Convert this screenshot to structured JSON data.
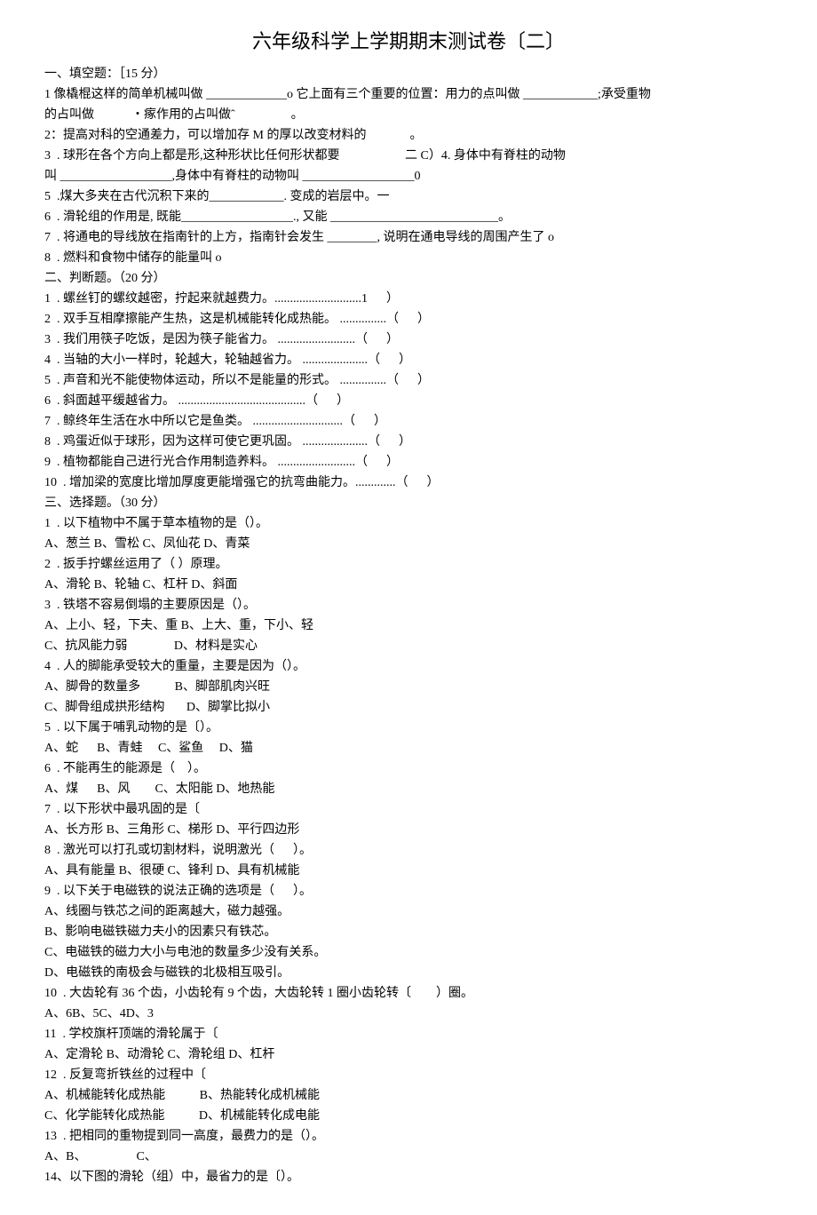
{
  "title": "六年级科学上学期期末测试卷〔二〕",
  "sections": {
    "fill": {
      "header": "一、填空题：［15 分）",
      "q1a": "1 像橇棍这样的简单机械叫做 _____________o 它上面有三个重要的位置：用力的点叫做 ____________;承受重物",
      "q1b": "的占叫做            ・瘃作用的占叫做ˆ                  。",
      "q2": "2：提高对科的空通差力，可以增加存 M 的厚以改变材料的              。",
      "q3": "3  . 球形在各个方向上都是形,这种形状比任何形状都要                     二 C）4. 身体中有脊柱的动物",
      "q3b": "叫 __________________,身体中有脊柱的动物叫 __________________0",
      "q5": "5  .煤大多夹在古代沉积下来的____________. 变成的岩层中。一",
      "q6": "6  . 滑轮组的作用是, 既能__________________., 又能 ___________________________。",
      "q7": "7  . 将通电的导线放在指南针的上方，指南针会发生 ________, 说明在通电导线的周围产生了 o",
      "q8": "8  . 燃料和食物中储存的能量叫 o"
    },
    "judge": {
      "header": "二、判断题。（20 分）",
      "items": [
        "1  . 螺丝钉的螺纹越密，拧起来就越费力。............................1      ）",
        "2  . 双手互相摩擦能产生热，这是机械能转化成热能。 ...............（      ）",
        "3  . 我们用筷子吃饭，是因为筷子能省力。 .........................（      ）",
        "4  . 当轴的大小一样时，轮越大，轮轴越省力。 .....................（      ）",
        "5  . 声音和光不能使物体运动，所以不是能量的形式。 ...............（      ）",
        "6  . 斜面越平缓越省力。 .........................................（      ）",
        "7  . 鲸终年生活在水中所以它是鱼类。 .............................（      ）",
        "8  . 鸡蛋近似于球形，因为这样可使它更巩固。 .....................（      ）",
        "9  . 植物都能自己进行光合作用制造养料。 .........................（      ）",
        "10  . 增加梁的宽度比增加厚度更能增强它的抗弯曲能力。.............（      ）"
      ]
    },
    "choice": {
      "header": "三、选择题。（30 分）",
      "q1": "1  . 以下植物中不属于草本植物的是（）。",
      "q1a": "A、葱兰 B、雪松 C、凤仙花 D、青菜",
      "q2": "2  . 扳手拧螺丝运用了（ ）原理。",
      "q2a": "A、滑轮 B、轮轴 C、杠杆 D、斜面",
      "q3": "3  . 铁塔不容易倒塌的主要原因是（）。",
      "q3a": "A、上小、轻，下夫、重 B、上大、重，下小、轻",
      "q3b": "C、抗风能力弱               D、材料是实心",
      "q4": "4  . 人的脚能承受较大的重量，主要是因为（）。",
      "q4a": "A、脚骨的数量多           B、脚部肌肉兴旺",
      "q4b": "C、脚骨组成拱形结构       D、脚掌比拟小",
      "q5": "5  . 以下属于哺乳动物的是〔）。",
      "q5a": "A、蛇      B、青蛙     C、鲨鱼     D、猫",
      "q6": "6  . 不能再生的能源是（    ）。",
      "q6a": "A、煤      B、风        C、太阳能 D、地热能",
      "q7": "7  . 以下形状中最巩固的是〔",
      "q7a": "A、长方形 B、三角形 C、梯形 D、平行四边形",
      "q8": "8  . 激光可以打孔或切割材料，说明激光（      ）。",
      "q8a": "A、具有能量 B、很硬 C、锋利 D、具有机械能",
      "q9": "9  . 以下关于电磁铁的说法正确的选项是（      ）。",
      "q9a": "A、线圈与铁芯之间的距离越大，磁力越强。",
      "q9b": "B、影响电磁铁磁力夫小的因素只有铁芯。",
      "q9c": "C、电磁铁的磁力大小与电池的数量多少没有关系。",
      "q9d": "D、电磁铁的南极会与磁铁的北极相互吸引。",
      "q10": "10  . 大齿轮有 36 个齿，小齿轮有 9 个齿，大齿轮转 1 圈小齿轮转〔        ）圈。",
      "q10a": "A、6B、5C、4D、3",
      "q11": "11  . 学校旗杆顶端的滑轮属于〔",
      "q11a": "A、定滑轮 B、动滑轮 C、滑轮组 D、杠杆",
      "q12": "12  . 反复弯折铁丝的过程中〔",
      "q12a": "A、机械能转化成热能           B、热能转化成机械能",
      "q12b": "C、化学能转化成热能           D、机械能转化成电能",
      "q13": "13  . 把相同的重物提到同一高度，最费力的是（）。",
      "q13a": "A、B、                C、",
      "q14": "14、以下图的滑轮（组）中，最省力的是〔）。"
    }
  }
}
